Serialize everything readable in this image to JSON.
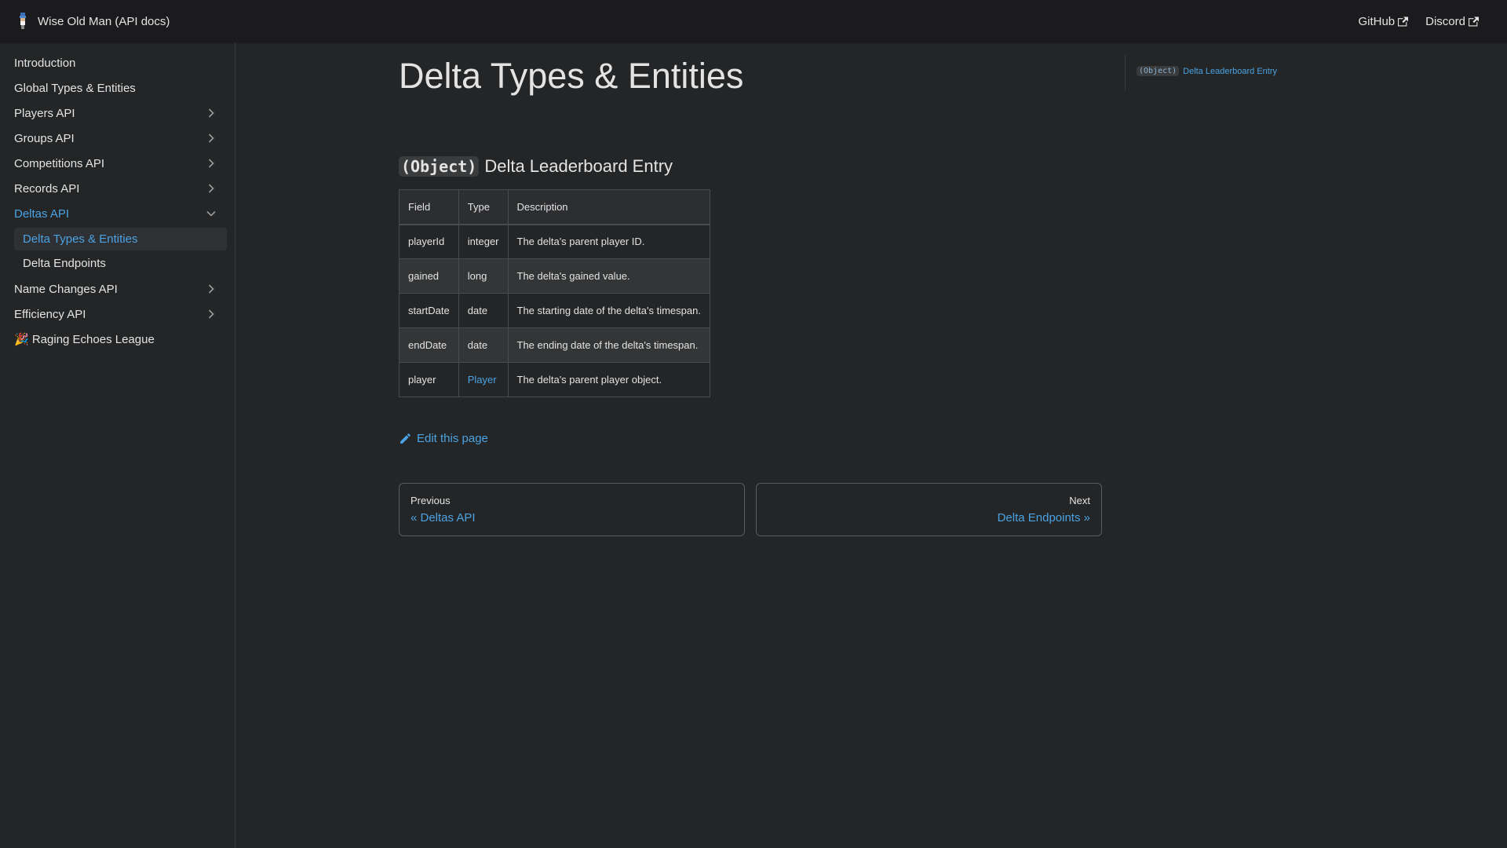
{
  "navbar": {
    "title": "Wise Old Man (API docs)",
    "links": [
      {
        "label": "GitHub",
        "icon": "external-link-icon"
      },
      {
        "label": "Discord",
        "icon": "external-link-icon"
      }
    ]
  },
  "sidebar": {
    "items": [
      {
        "label": "Introduction"
      },
      {
        "label": "Global Types & Entities"
      },
      {
        "label": "Players API",
        "icon": "chevron-right-icon"
      },
      {
        "label": "Groups API",
        "icon": "chevron-right-icon"
      },
      {
        "label": "Competitions API",
        "icon": "chevron-right-icon"
      },
      {
        "label": "Records API",
        "icon": "chevron-right-icon"
      },
      {
        "label": "Deltas API",
        "icon": "chevron-down-icon",
        "expanded": true,
        "children": [
          {
            "label": "Delta Types & Entities",
            "active": true
          },
          {
            "label": "Delta Endpoints"
          }
        ]
      },
      {
        "label": "Name Changes API",
        "icon": "chevron-right-icon"
      },
      {
        "label": "Efficiency API",
        "icon": "chevron-right-icon"
      },
      {
        "label": "🎉 Raging Echoes League"
      }
    ]
  },
  "main": {
    "title": "Delta Types & Entities",
    "section": {
      "chip": "(Object)",
      "heading": "Delta Leaderboard Entry"
    },
    "table": {
      "headers": [
        "Field",
        "Type",
        "Description"
      ],
      "rows": [
        [
          "playerId",
          "integer",
          "The delta's parent player ID."
        ],
        [
          "gained",
          "long",
          "The delta's gained value."
        ],
        [
          "startDate",
          "date",
          "The starting date of the delta's timespan."
        ],
        [
          "endDate",
          "date",
          "The ending date of the delta's timespan."
        ],
        [
          "player",
          "Player",
          "The delta's parent player object."
        ]
      ]
    },
    "edit_label": "Edit this page",
    "pager": {
      "prev_sub": "Previous",
      "prev_label": "« Deltas API",
      "next_sub": "Next",
      "next_label": "Delta Endpoints »"
    }
  },
  "toc": {
    "chip": "(Object)",
    "label": "Delta Leaderboard Entry"
  },
  "colors": {
    "background": "#242526",
    "navbar": "#1b1b1d",
    "accent": "#4ba3e3",
    "text": "#e3e3e3"
  }
}
